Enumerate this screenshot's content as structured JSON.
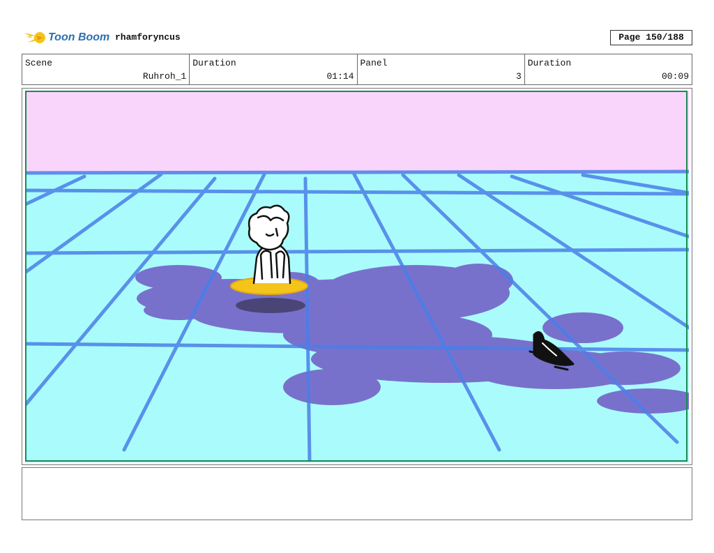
{
  "header": {
    "logo_text": "Toon Boom",
    "project_name": "rhamforyncus",
    "page_label": "Page 150/188"
  },
  "info": {
    "scene_label": "Scene",
    "scene_value": "Ruhroh_1",
    "duration_label": "Duration",
    "duration_value": "01:14",
    "panel_label": "Panel",
    "panel_value": "3",
    "panel_duration_label": "Duration",
    "panel_duration_value": "00:09"
  },
  "colors": {
    "sky": "#f9d5fc",
    "floor": "#aafcfc",
    "grid": "#4a7fe8",
    "shadow": "#7466c8",
    "float_ring": "#f5c41a",
    "logo_blue": "#2d6fb3",
    "logo_yellow": "#f5c31a"
  },
  "notes": {
    "text": ""
  }
}
